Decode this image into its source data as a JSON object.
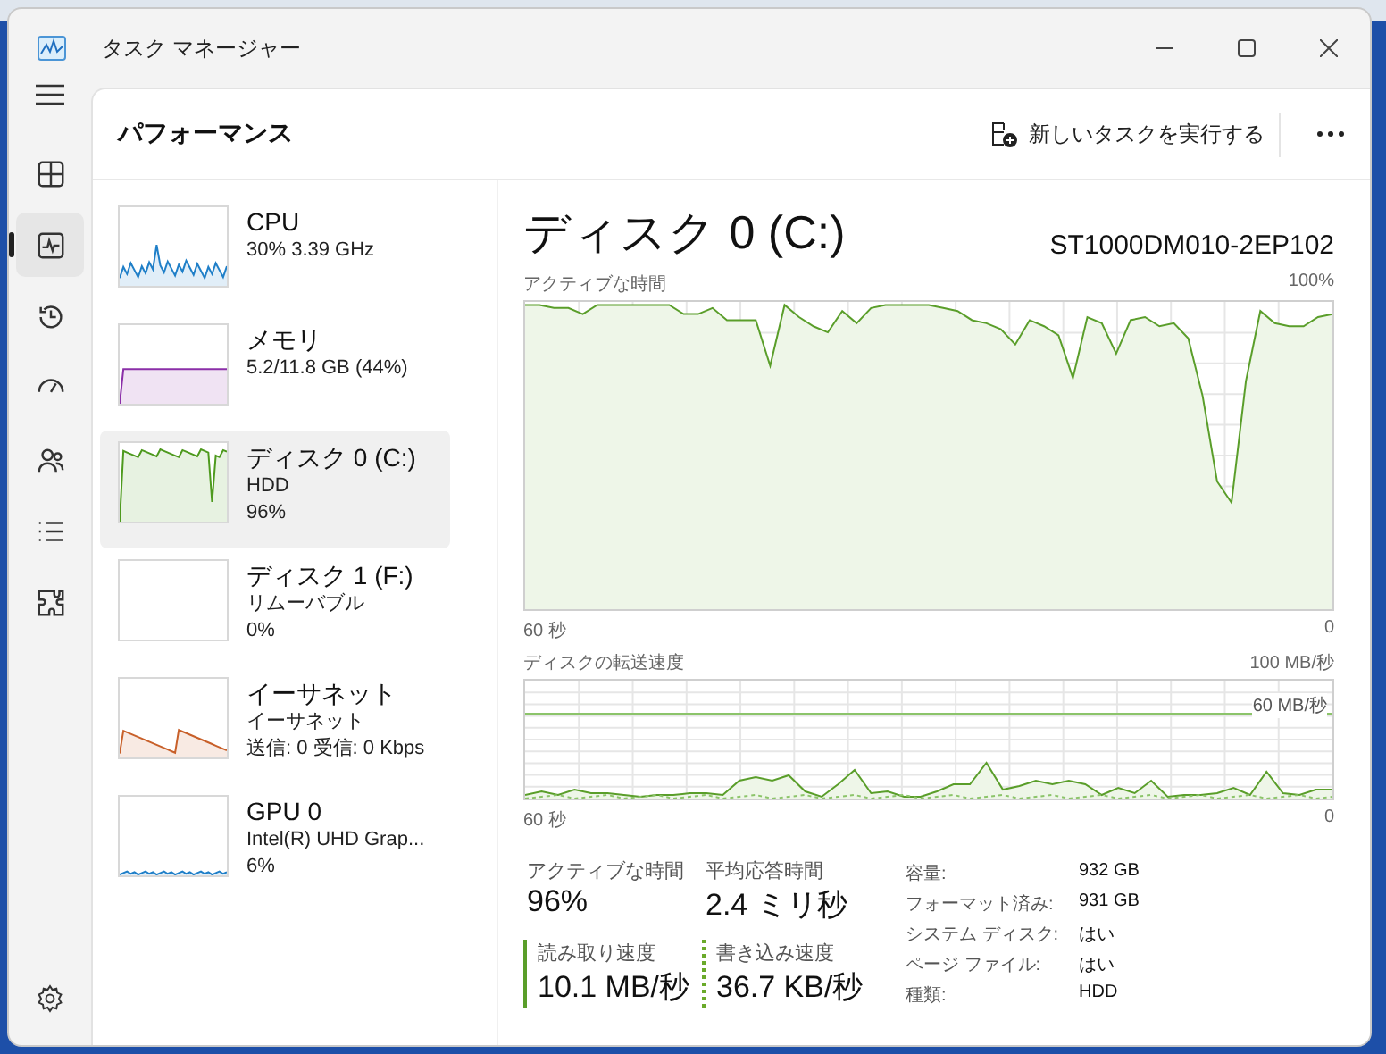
{
  "window": {
    "title": "タスク マネージャー"
  },
  "nav": [
    {
      "kind": "processes",
      "selected": false
    },
    {
      "kind": "performance",
      "selected": true
    },
    {
      "kind": "history",
      "selected": false
    },
    {
      "kind": "startup",
      "selected": false
    },
    {
      "kind": "users",
      "selected": false
    },
    {
      "kind": "details",
      "selected": false
    },
    {
      "kind": "services",
      "selected": false
    }
  ],
  "header": {
    "title": "パフォーマンス",
    "new_task": "新しいタスクを実行する"
  },
  "devices": [
    {
      "kind": "cpu",
      "name": "CPU",
      "lines": [
        "30%  3.39 GHz"
      ],
      "selected": false
    },
    {
      "kind": "memory",
      "name": "メモリ",
      "lines": [
        "5.2/11.8 GB (44%)"
      ],
      "selected": false
    },
    {
      "kind": "disk",
      "name": "ディスク 0 (C:)",
      "lines": [
        "HDD",
        "96%"
      ],
      "selected": true
    },
    {
      "kind": "empty",
      "name": "ディスク 1 (F:)",
      "lines": [
        "リムーバブル",
        "0%"
      ],
      "selected": false
    },
    {
      "kind": "network",
      "name": "イーサネット",
      "lines": [
        "イーサネット",
        "送信: 0 受信: 0 Kbps"
      ],
      "selected": false
    },
    {
      "kind": "gpu",
      "name": "GPU 0",
      "lines": [
        "Intel(R) UHD Grap...",
        "6%"
      ],
      "selected": false
    }
  ],
  "detail": {
    "title": "ディスク 0 (C:)",
    "model": "ST1000DM010-2EP102",
    "active_chart": {
      "label": "アクティブな時間",
      "max": "100%",
      "x_start": "60 秒",
      "x_end": "0"
    },
    "transfer_chart": {
      "label": "ディスクの転送速度",
      "max": "100 MB/秒",
      "marker": "60 MB/秒",
      "x_start": "60 秒",
      "x_end": "0"
    },
    "stats": [
      {
        "label": "アクティブな時間",
        "value": "96%"
      },
      {
        "label": "平均応答時間",
        "value": "2.4 ミリ秒"
      }
    ],
    "rates": [
      {
        "kind": "solid",
        "label": "読み取り速度",
        "value": "10.1 MB/秒"
      },
      {
        "kind": "dashed",
        "label": "書き込み速度",
        "value": "36.7 KB/秒"
      }
    ],
    "properties": [
      {
        "label": "容量:",
        "value": "932 GB"
      },
      {
        "label": "フォーマット済み:",
        "value": "931 GB"
      },
      {
        "label": "システム ディスク:",
        "value": "はい"
      },
      {
        "label": "ページ ファイル:",
        "value": "はい"
      },
      {
        "label": "種類:",
        "value": "HDD"
      }
    ]
  }
}
